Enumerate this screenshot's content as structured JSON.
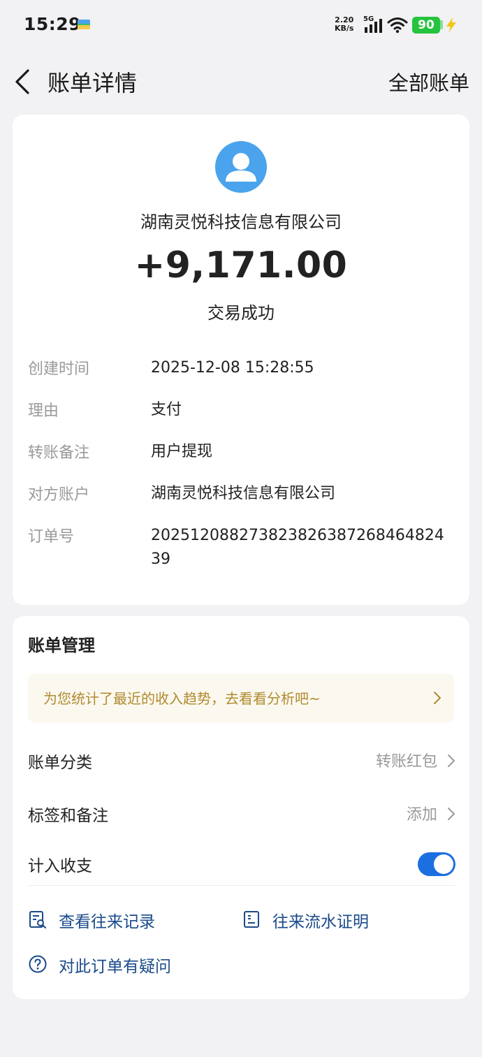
{
  "status_bar": {
    "time": "15:29",
    "net_speed_value": "2.20",
    "net_speed_unit": "KB/s",
    "network_type": "5G",
    "battery": "90"
  },
  "nav": {
    "title": "账单详情",
    "right_action": "全部账单"
  },
  "transaction": {
    "counterparty": "湖南灵悦科技信息有限公司",
    "amount": "+9,171.00",
    "status": "交易成功"
  },
  "details": [
    {
      "label": "创建时间",
      "value": "2025-12-08 15:28:55"
    },
    {
      "label": "理由",
      "value": "支付"
    },
    {
      "label": "转账备注",
      "value": "用户提现"
    },
    {
      "label": "对方账户",
      "value": "湖南灵悦科技信息有限公司"
    },
    {
      "label": "订单号",
      "value": "20251208827382382638726846482439"
    }
  ],
  "management": {
    "title": "账单管理",
    "promo": "为您统计了最近的收入趋势，去看看分析吧~",
    "category": {
      "label": "账单分类",
      "value": "转账红包"
    },
    "tags": {
      "label": "标签和备注",
      "value": "添加"
    },
    "include": {
      "label": "计入收支",
      "enabled": true
    }
  },
  "links": {
    "records": "查看往来记录",
    "proof": "往来流水证明",
    "question": "对此订单有疑问"
  },
  "colors": {
    "accent": "#1b6fe0",
    "link": "#1a4a8a",
    "promo_text": "#b08a2e",
    "avatar": "#4aa3ec",
    "battery": "#26c43e"
  }
}
